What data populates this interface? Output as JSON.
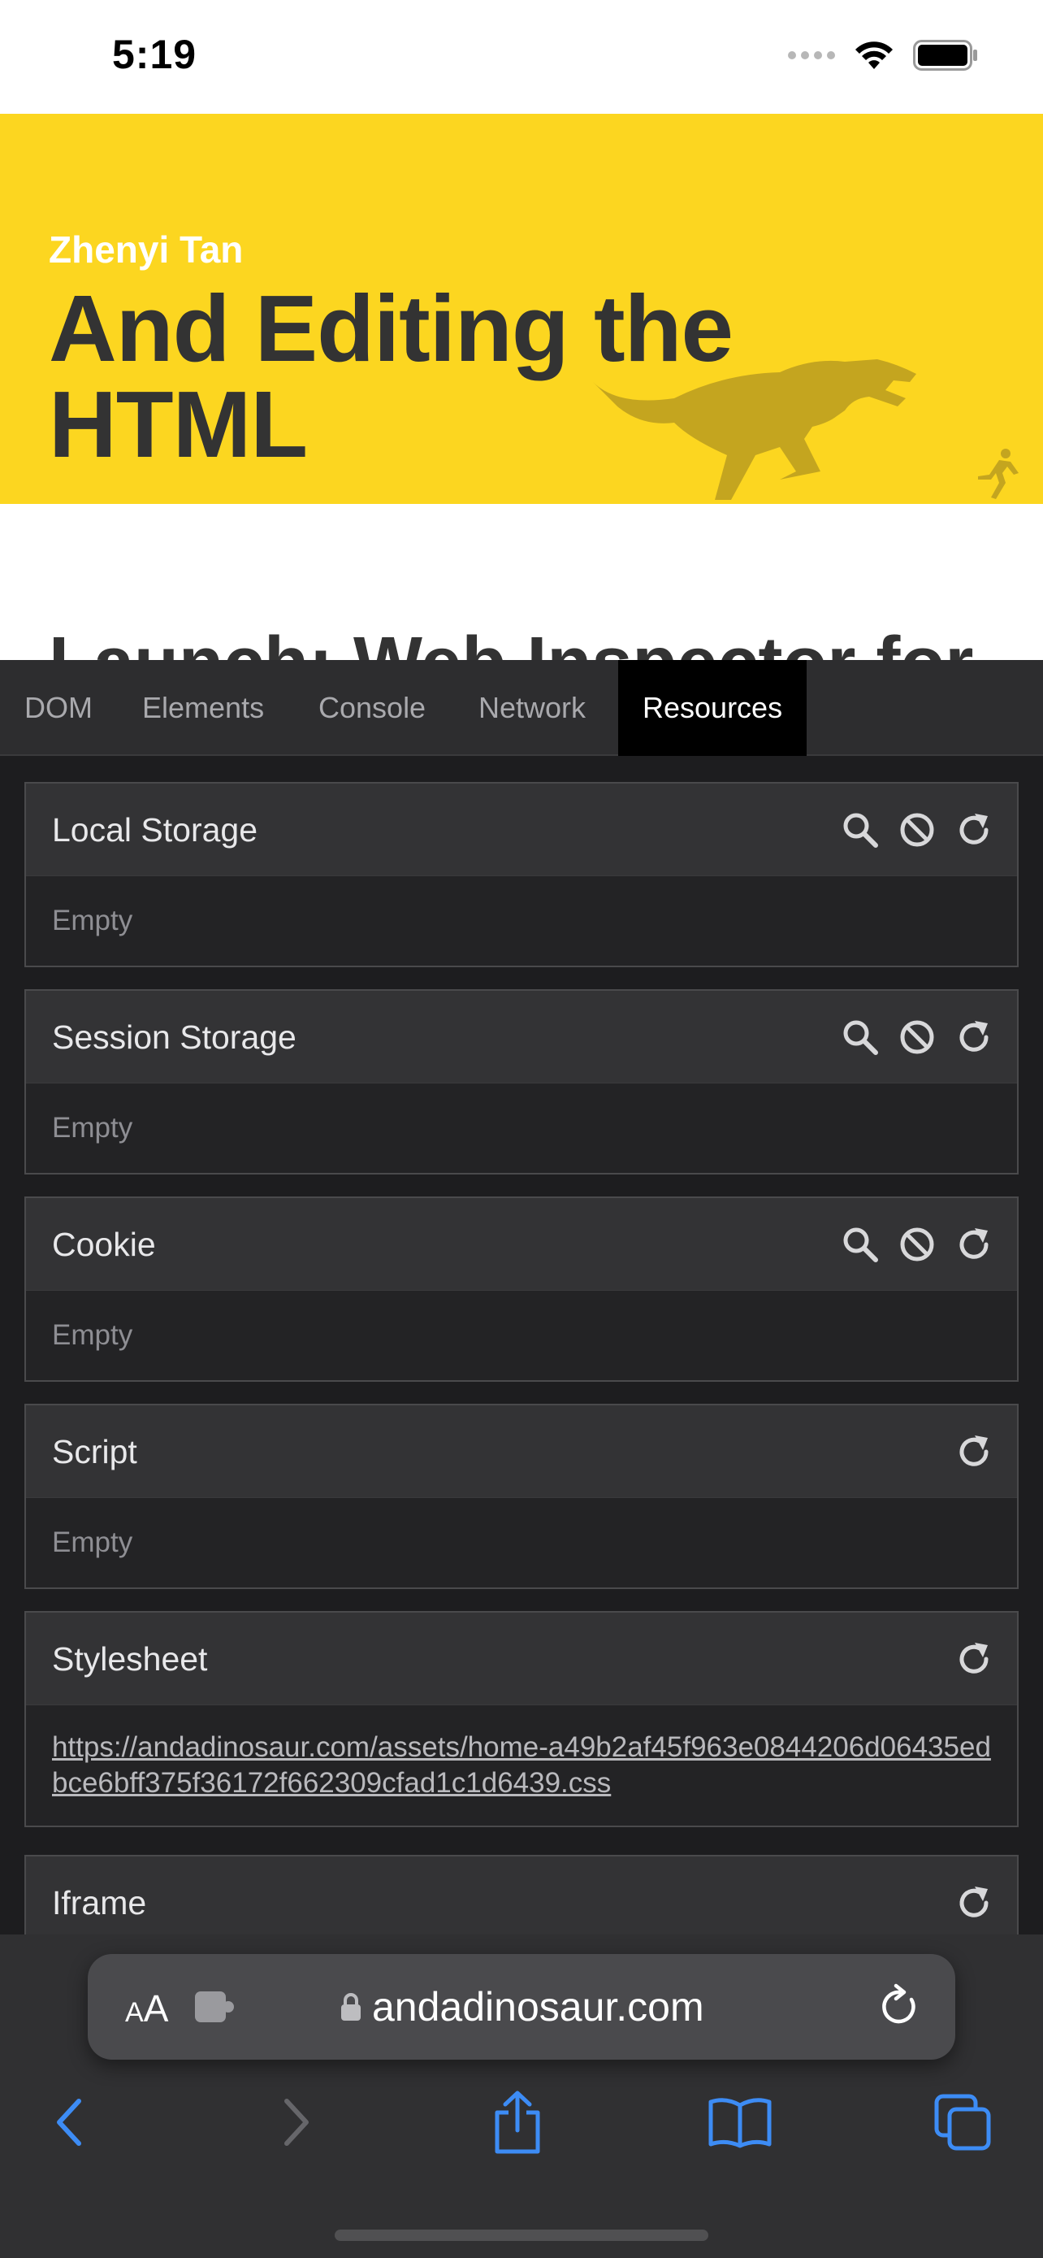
{
  "status_bar": {
    "time": "5:19"
  },
  "hero": {
    "author": "Zhenyi Tan",
    "title": "And Editing the HTML"
  },
  "article": {
    "heading": "Launch: Web Inspector for"
  },
  "inspector": {
    "tabs": [
      {
        "label": "DOM",
        "active": false
      },
      {
        "label": "Elements",
        "active": false
      },
      {
        "label": "Console",
        "active": false
      },
      {
        "label": "Network",
        "active": false
      },
      {
        "label": "Resources",
        "active": true
      }
    ],
    "panels": [
      {
        "title": "Local Storage",
        "body": "Empty"
      },
      {
        "title": "Session Storage",
        "body": "Empty"
      },
      {
        "title": "Cookie",
        "body": "Empty"
      },
      {
        "title": "Script",
        "body": "Empty"
      },
      {
        "title": "Stylesheet",
        "link": "https://andadinosaur.com/assets/home-a49b2af45f963e0844206d06435edbce6bff375f36172f662309cfad1c1d6439.css"
      },
      {
        "title": "Iframe"
      }
    ]
  },
  "browser": {
    "aa_small": "A",
    "aa_large": "A",
    "url": "andadinosaur.com"
  },
  "colors": {
    "hero_bg": "#fcd620",
    "accent_blue": "#3d8cf5",
    "inspector_bg": "#1d1d1f"
  },
  "icons": [
    "search-icon",
    "clear-icon",
    "refresh-icon",
    "back-icon",
    "forward-icon",
    "share-icon",
    "bookmarks-icon",
    "tabs-icon",
    "lock-icon",
    "extension-icon",
    "reload-icon",
    "wifi-icon",
    "battery-icon"
  ]
}
